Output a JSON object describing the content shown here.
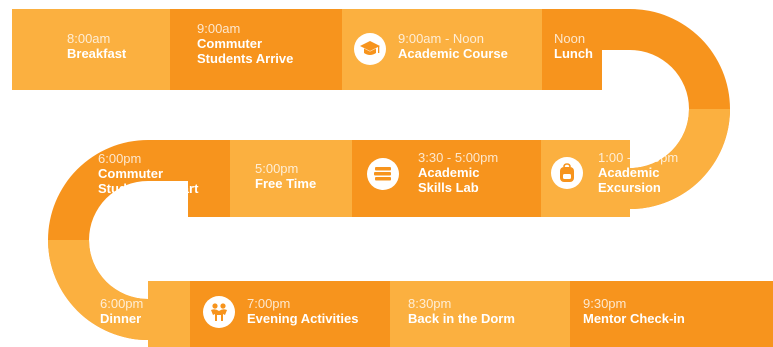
{
  "colors": {
    "light": "#fbb040",
    "dark": "#f7941d",
    "text": "#ffffff"
  },
  "row1": [
    {
      "time": "8:00am",
      "title": "Breakfast"
    },
    {
      "time": "9:00am",
      "title": "Commuter",
      "title2": "Students Arrive"
    },
    {
      "time": "9:00am - Noon",
      "title": "Academic Course",
      "icon": "graduation-cap-icon"
    },
    {
      "time": "Noon",
      "title": "Lunch"
    }
  ],
  "row2": [
    {
      "time": "6:00pm",
      "title": "Commuter",
      "title2": "Students Depart"
    },
    {
      "time": "5:00pm",
      "title": "Free Time"
    },
    {
      "time": "3:30 - 5:00pm",
      "title": "Academic",
      "title2": "Skills Lab",
      "icon": "book-stack-icon"
    },
    {
      "time": "1:00 - 3:00pm",
      "title": "Academic",
      "title2": "Excursion",
      "icon": "backpack-icon"
    }
  ],
  "row3": [
    {
      "time": "6:00pm",
      "title": "Dinner"
    },
    {
      "time": "7:00pm",
      "title": "Evening Activities",
      "icon": "people-icon"
    },
    {
      "time": "8:30pm",
      "title": "Back in the Dorm"
    },
    {
      "time": "9:30pm",
      "title": "Mentor Check-in"
    }
  ]
}
